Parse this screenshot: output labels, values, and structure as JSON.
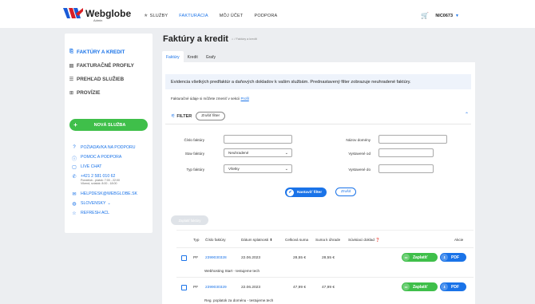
{
  "brand": {
    "name": "Webglobe",
    "sub": "Admin"
  },
  "nav": {
    "items": [
      {
        "label": "SLUŽBY",
        "icon": "star-icon"
      },
      {
        "label": "FAKTURÁCIA",
        "active": true
      },
      {
        "label": "MÔJ ÚČET"
      },
      {
        "label": "PODPORA"
      }
    ],
    "user": "NIC0673",
    "cart_icon": "cart-icon"
  },
  "sidebar": {
    "items": [
      {
        "label": "FAKTÚRY A KREDIT",
        "active": true,
        "icon": "invoice-icon"
      },
      {
        "label": "FAKTURAČNÉ PROFILY",
        "icon": "profile-card-icon"
      },
      {
        "label": "PREHĽAD SLUŽIEB",
        "icon": "list-icon"
      },
      {
        "label": "PROVÍZIE",
        "icon": "commission-icon"
      }
    ],
    "new_service": "NOVÁ SLUŽBA",
    "help": {
      "request": "POŽIADAVKA NA PODPORU",
      "help": "POMOC A PODPORA",
      "chat": "LIVE CHAT",
      "phone": "+421 2 581 010 62",
      "phone_hours_1": "Pondelok - piatok: 7:00 - 22:00",
      "phone_hours_2": "Víkend, sviatok: 8:00 - 18:00",
      "email": "HELPDESK@WEBGLOBE.SK",
      "language": "SLOVENSKY",
      "refresh": "REFRESH ACL"
    }
  },
  "page": {
    "title": "Faktúry a kredit",
    "breadcrumb": "/ Faktúry a kredit",
    "tabs": [
      "Faktúry",
      "Kredit",
      "Grafy"
    ],
    "active_tab": 0,
    "info": "Evidencia všetkých predfaktúr a daňových dokladov k vašim službám. Prednastavený filter zobrazuje neuhradené faktúry.",
    "profile_note": "Fakturačné údaje si môžete zmeniť v sekcii",
    "profile_link": "Profil"
  },
  "filter": {
    "label": "FILTER",
    "clear": "Zrušiť filter",
    "fields": {
      "invoice_number": {
        "label": "Číslo faktúry",
        "value": ""
      },
      "invoice_status": {
        "label": "Stav faktúry",
        "value": "Neuhradené"
      },
      "invoice_type": {
        "label": "Typ faktúry",
        "value": "Všetky"
      },
      "domain_name": {
        "label": "Názov domény",
        "value": ""
      },
      "issued_from": {
        "label": "Vystavené od",
        "value": ""
      },
      "issued_to": {
        "label": "Vystavené do",
        "value": ""
      }
    },
    "apply": "Nastaviť filter",
    "cancel": "Zrušiť"
  },
  "bulk_action": "Zaplatiť faktúry",
  "table": {
    "headers": {
      "type": "Typ",
      "number": "Číslo faktúry",
      "due": "Dátum splatnosti",
      "total": "Celková suma",
      "to_pay": "Suma k úhrade",
      "related": "Súvisiaci doklad",
      "actions": "Akcie"
    },
    "rows": [
      {
        "type": "PF",
        "number": "2399030328",
        "due": "22.06.2023",
        "total": "28,55 €",
        "to_pay": "28,55 €",
        "desc": "Webhosting Start - testujeme tech",
        "pay": "Zaplatiť",
        "pdf": "PDF"
      },
      {
        "type": "PF",
        "number": "2399030329",
        "due": "22.06.2023",
        "total": "47,99 €",
        "to_pay": "47,99 €",
        "desc": "Reg. poplatok za doménu - testujeme.tech",
        "pay": "Zaplatiť",
        "pdf": "PDF"
      }
    ]
  },
  "colors": {
    "accent": "#1a73e8",
    "success": "#3fbf4a",
    "background": "#eceef1"
  }
}
